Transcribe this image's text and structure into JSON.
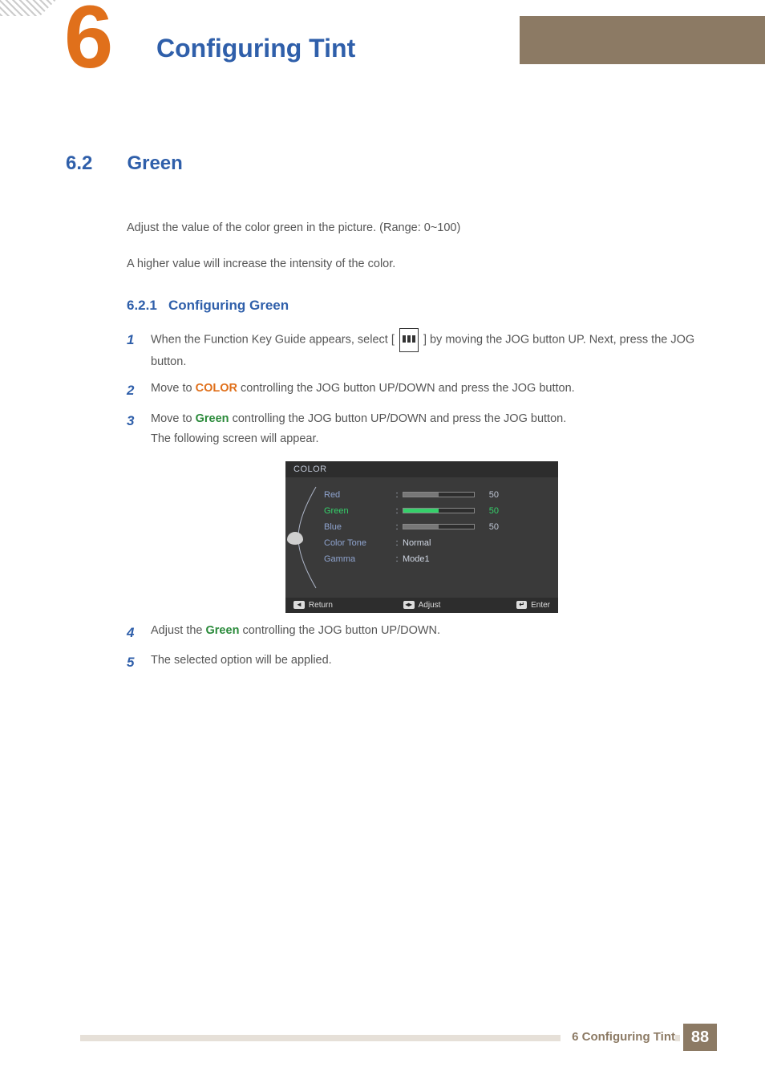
{
  "chapter": {
    "number": "6",
    "title": "Configuring Tint"
  },
  "section": {
    "number": "6.2",
    "title": "Green"
  },
  "intro": {
    "p1": "Adjust the value of the color green in the picture. (Range: 0~100)",
    "p2": "A higher value will increase the intensity of the color."
  },
  "subsection": {
    "number": "6.2.1",
    "title": "Configuring Green"
  },
  "steps": {
    "s1": {
      "num": "1",
      "pre": "When the Function Key Guide appears, select  [",
      "post": "]  by moving the JOG button UP. Next, press the JOG button."
    },
    "s2": {
      "num": "2",
      "pre": "Move to ",
      "kw": "COLOR",
      "post": " controlling the JOG button UP/DOWN and press the JOG button."
    },
    "s3": {
      "num": "3",
      "pre": "Move to ",
      "kw": "Green",
      "post": " controlling the JOG button UP/DOWN and press the JOG button.",
      "line2": "The following screen will appear."
    },
    "s4": {
      "num": "4",
      "pre": "Adjust the ",
      "kw": "Green",
      "post": " controlling the JOG button UP/DOWN."
    },
    "s5": {
      "num": "5",
      "text": "The selected option will be applied."
    }
  },
  "osd": {
    "title": "COLOR",
    "rows": [
      {
        "label": "Red",
        "type": "slider",
        "fill": 50,
        "value": "50",
        "selected": false
      },
      {
        "label": "Green",
        "type": "slider",
        "fill": 50,
        "value": "50",
        "selected": true
      },
      {
        "label": "Blue",
        "type": "slider",
        "fill": 50,
        "value": "50",
        "selected": false
      },
      {
        "label": "Color Tone",
        "type": "text",
        "value": "Normal"
      },
      {
        "label": "Gamma",
        "type": "text",
        "value": "Mode1"
      }
    ],
    "footer": {
      "return": "Return",
      "adjust": "Adjust",
      "enter": "Enter"
    }
  },
  "footer": {
    "label": "6 Configuring Tint",
    "page": "88"
  }
}
